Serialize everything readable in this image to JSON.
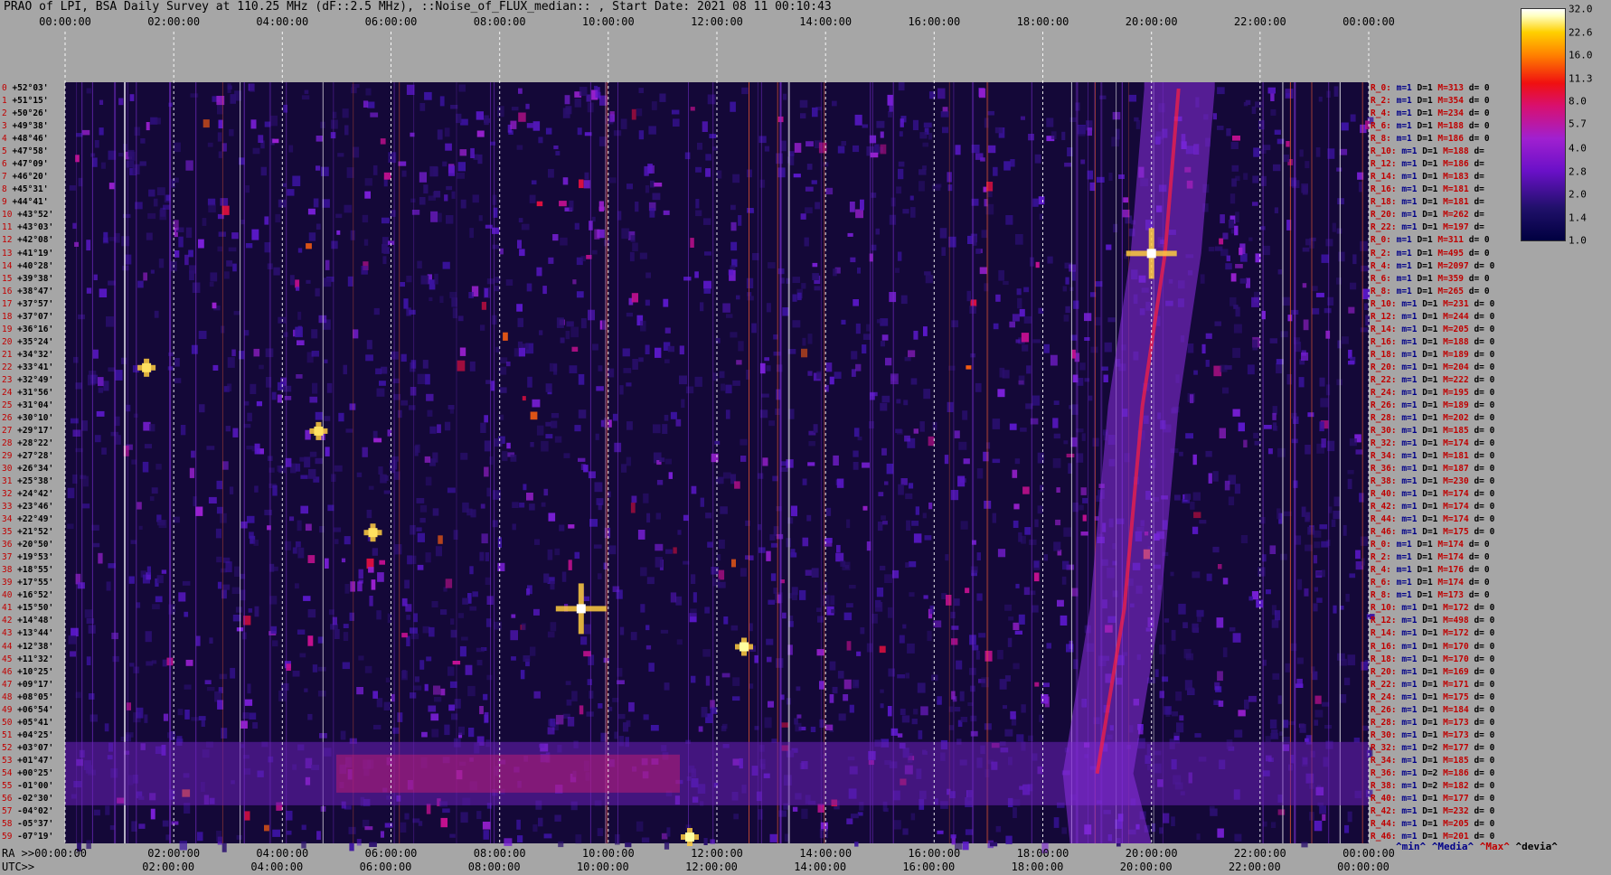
{
  "title": "PRAO of LPI, BSA Daily Survey at 110.25 MHz (dF::2.5 MHz), ::Noise_of_FLUX_median:: , Start Date: 2021 08 11 00:10:43",
  "chart_data": {
    "type": "heatmap",
    "title": "PRAO of LPI, BSA Daily Survey at 110.25 MHz (dF::2.5 MHz), ::Noise_of_FLUX_median:: , Start Date: 2021 08 11 00:10:43",
    "x_ticks_top": [
      "00:00:00",
      "02:00:00",
      "04:00:00",
      "06:00:00",
      "08:00:00",
      "10:00:00",
      "12:00:00",
      "14:00:00",
      "16:00:00",
      "18:00:00",
      "20:00:00",
      "22:00:00",
      "00:00:00"
    ],
    "x_ticks_ra": [
      "02:00:00",
      "04:00:00",
      "06:00:00",
      "08:00:00",
      "10:00:00",
      "12:00:00",
      "14:00:00",
      "16:00:00",
      "18:00:00",
      "20:00:00",
      "22:00:00",
      "00:00:00"
    ],
    "x_ticks_utc": [
      "02:00:00",
      "04:00:00",
      "06:00:00",
      "08:00:00",
      "10:00:00",
      "12:00:00",
      "14:00:00",
      "16:00:00",
      "18:00:00",
      "20:00:00",
      "22:00:00",
      "00:00:00"
    ],
    "ra_label": "RA >>00:00:00",
    "utc_label": "UTC>>",
    "colorbar_ticks": [
      "32.0",
      "22.6",
      "16.0",
      "11.3",
      "8.0",
      "5.7",
      "4.0",
      "2.8",
      "2.0",
      "1.4",
      "1.0"
    ],
    "colorbar_range": [
      1.0,
      32.0
    ],
    "colorbar_scale": "log",
    "dec_labels": [
      {
        "i": "0",
        "d": "+52°03'"
      },
      {
        "i": "1",
        "d": "+51°15'"
      },
      {
        "i": "2",
        "d": "+50°26'"
      },
      {
        "i": "3",
        "d": "+49°38'"
      },
      {
        "i": "4",
        "d": "+48°46'"
      },
      {
        "i": "5",
        "d": "+47°58'"
      },
      {
        "i": "6",
        "d": "+47°09'"
      },
      {
        "i": "7",
        "d": "+46°20'"
      },
      {
        "i": "8",
        "d": "+45°31'"
      },
      {
        "i": "9",
        "d": "+44°41'"
      },
      {
        "i": "10",
        "d": "+43°52'"
      },
      {
        "i": "11",
        "d": "+43°03'"
      },
      {
        "i": "12",
        "d": "+42°08'"
      },
      {
        "i": "13",
        "d": "+41°19'"
      },
      {
        "i": "14",
        "d": "+40°28'"
      },
      {
        "i": "15",
        "d": "+39°38'"
      },
      {
        "i": "16",
        "d": "+38°47'"
      },
      {
        "i": "17",
        "d": "+37°57'"
      },
      {
        "i": "18",
        "d": "+37°07'"
      },
      {
        "i": "19",
        "d": "+36°16'"
      },
      {
        "i": "20",
        "d": "+35°24'"
      },
      {
        "i": "21",
        "d": "+34°32'"
      },
      {
        "i": "22",
        "d": "+33°41'"
      },
      {
        "i": "23",
        "d": "+32°49'"
      },
      {
        "i": "24",
        "d": "+31°56'"
      },
      {
        "i": "25",
        "d": "+31°04'"
      },
      {
        "i": "26",
        "d": "+30°10'"
      },
      {
        "i": "27",
        "d": "+29°17'"
      },
      {
        "i": "28",
        "d": "+28°22'"
      },
      {
        "i": "29",
        "d": "+27°28'"
      },
      {
        "i": "30",
        "d": "+26°34'"
      },
      {
        "i": "31",
        "d": "+25°38'"
      },
      {
        "i": "32",
        "d": "+24°42'"
      },
      {
        "i": "33",
        "d": "+23°46'"
      },
      {
        "i": "34",
        "d": "+22°49'"
      },
      {
        "i": "35",
        "d": "+21°52'"
      },
      {
        "i": "36",
        "d": "+20°50'"
      },
      {
        "i": "37",
        "d": "+19°53'"
      },
      {
        "i": "38",
        "d": "+18°55'"
      },
      {
        "i": "39",
        "d": "+17°55'"
      },
      {
        "i": "40",
        "d": "+16°52'"
      },
      {
        "i": "41",
        "d": "+15°50'"
      },
      {
        "i": "42",
        "d": "+14°48'"
      },
      {
        "i": "43",
        "d": "+13°44'"
      },
      {
        "i": "44",
        "d": "+12°38'"
      },
      {
        "i": "45",
        "d": "+11°32'"
      },
      {
        "i": "46",
        "d": "+10°25'"
      },
      {
        "i": "47",
        "d": "+09°17'"
      },
      {
        "i": "48",
        "d": "+08°05'"
      },
      {
        "i": "49",
        "d": "+06°54'"
      },
      {
        "i": "50",
        "d": "+05°41'"
      },
      {
        "i": "51",
        "d": "+04°25'"
      },
      {
        "i": "52",
        "d": "+03°07'"
      },
      {
        "i": "53",
        "d": "+01°47'"
      },
      {
        "i": "54",
        "d": "+00°25'"
      },
      {
        "i": "55",
        "d": "-01°00'"
      },
      {
        "i": "56",
        "d": "-02°30'"
      },
      {
        "i": "57",
        "d": "-04°02'"
      },
      {
        "i": "58",
        "d": "-05°37'"
      },
      {
        "i": "59",
        "d": "-07°19'"
      }
    ],
    "stats_rows": [
      {
        "r": "R_0:",
        "m": "m=1",
        "D": "D=1",
        "M": "M=313",
        "d": "d= 0"
      },
      {
        "r": "R_2:",
        "m": "m=1",
        "D": "D=1",
        "M": "M=354",
        "d": "d= 0"
      },
      {
        "r": "R_4:",
        "m": "m=1",
        "D": "D=1",
        "M": "M=234",
        "d": "d= 0"
      },
      {
        "r": "R_6:",
        "m": "m=1",
        "D": "D=1",
        "M": "M=188",
        "d": "d= 0"
      },
      {
        "r": "R_8:",
        "m": "m=1",
        "D": "D=1",
        "M": "M=186",
        "d": "d= 0"
      },
      {
        "r": "R_10:",
        "m": "m=1",
        "D": "D=1",
        "M": "M=188",
        "d": "d="
      },
      {
        "r": "R_12:",
        "m": "m=1",
        "D": "D=1",
        "M": "M=186",
        "d": "d="
      },
      {
        "r": "R_14:",
        "m": "m=1",
        "D": "D=1",
        "M": "M=183",
        "d": "d="
      },
      {
        "r": "R_16:",
        "m": "m=1",
        "D": "D=1",
        "M": "M=181",
        "d": "d="
      },
      {
        "r": "R_18:",
        "m": "m=1",
        "D": "D=1",
        "M": "M=181",
        "d": "d="
      },
      {
        "r": "R_20:",
        "m": "m=1",
        "D": "D=1",
        "M": "M=262",
        "d": "d="
      },
      {
        "r": "R_22:",
        "m": "m=1",
        "D": "D=1",
        "M": "M=197",
        "d": "d="
      },
      {
        "r": "R_0:",
        "m": "m=1",
        "D": "D=1",
        "M": "M=311",
        "d": "d= 0"
      },
      {
        "r": "R_2:",
        "m": "m=1",
        "D": "D=1",
        "M": "M=495",
        "d": "d= 0"
      },
      {
        "r": "R_4:",
        "m": "m=1",
        "D": "D=1",
        "M": "M=2097",
        "d": "d= 0"
      },
      {
        "r": "R_6:",
        "m": "m=1",
        "D": "D=1",
        "M": "M=359",
        "d": "d= 0"
      },
      {
        "r": "R_8:",
        "m": "m=1",
        "D": "D=1",
        "M": "M=265",
        "d": "d= 0"
      },
      {
        "r": "R_10:",
        "m": "m=1",
        "D": "D=1",
        "M": "M=231",
        "d": "d= 0"
      },
      {
        "r": "R_12:",
        "m": "m=1",
        "D": "D=1",
        "M": "M=244",
        "d": "d= 0"
      },
      {
        "r": "R_14:",
        "m": "m=1",
        "D": "D=1",
        "M": "M=205",
        "d": "d= 0"
      },
      {
        "r": "R_16:",
        "m": "m=1",
        "D": "D=1",
        "M": "M=188",
        "d": "d= 0"
      },
      {
        "r": "R_18:",
        "m": "m=1",
        "D": "D=1",
        "M": "M=189",
        "d": "d= 0"
      },
      {
        "r": "R_20:",
        "m": "m=1",
        "D": "D=1",
        "M": "M=204",
        "d": "d= 0"
      },
      {
        "r": "R_22:",
        "m": "m=1",
        "D": "D=1",
        "M": "M=222",
        "d": "d= 0"
      },
      {
        "r": "R_24:",
        "m": "m=1",
        "D": "D=1",
        "M": "M=195",
        "d": "d= 0"
      },
      {
        "r": "R_26:",
        "m": "m=1",
        "D": "D=1",
        "M": "M=189",
        "d": "d= 0"
      },
      {
        "r": "R_28:",
        "m": "m=1",
        "D": "D=1",
        "M": "M=202",
        "d": "d= 0"
      },
      {
        "r": "R_30:",
        "m": "m=1",
        "D": "D=1",
        "M": "M=185",
        "d": "d= 0"
      },
      {
        "r": "R_32:",
        "m": "m=1",
        "D": "D=1",
        "M": "M=174",
        "d": "d= 0"
      },
      {
        "r": "R_34:",
        "m": "m=1",
        "D": "D=1",
        "M": "M=181",
        "d": "d= 0"
      },
      {
        "r": "R_36:",
        "m": "m=1",
        "D": "D=1",
        "M": "M=187",
        "d": "d= 0"
      },
      {
        "r": "R_38:",
        "m": "m=1",
        "D": "D=1",
        "M": "M=230",
        "d": "d= 0"
      },
      {
        "r": "R_40:",
        "m": "m=1",
        "D": "D=1",
        "M": "M=174",
        "d": "d= 0"
      },
      {
        "r": "R_42:",
        "m": "m=1",
        "D": "D=1",
        "M": "M=174",
        "d": "d= 0"
      },
      {
        "r": "R_44:",
        "m": "m=1",
        "D": "D=1",
        "M": "M=174",
        "d": "d= 0"
      },
      {
        "r": "R_46:",
        "m": "m=1",
        "D": "D=1",
        "M": "M=175",
        "d": "d= 0"
      },
      {
        "r": "R_0:",
        "m": "m=1",
        "D": "D=1",
        "M": "M=174",
        "d": "d= 0"
      },
      {
        "r": "R_2:",
        "m": "m=1",
        "D": "D=1",
        "M": "M=174",
        "d": "d= 0"
      },
      {
        "r": "R_4:",
        "m": "m=1",
        "D": "D=1",
        "M": "M=176",
        "d": "d= 0"
      },
      {
        "r": "R_6:",
        "m": "m=1",
        "D": "D=1",
        "M": "M=174",
        "d": "d= 0"
      },
      {
        "r": "R_8:",
        "m": "m=1",
        "D": "D=1",
        "M": "M=173",
        "d": "d= 0"
      },
      {
        "r": "R_10:",
        "m": "m=1",
        "D": "D=1",
        "M": "M=172",
        "d": "d= 0"
      },
      {
        "r": "R_12:",
        "m": "m=1",
        "D": "D=1",
        "M": "M=498",
        "d": "d= 0"
      },
      {
        "r": "R_14:",
        "m": "m=1",
        "D": "D=1",
        "M": "M=172",
        "d": "d= 0"
      },
      {
        "r": "R_16:",
        "m": "m=1",
        "D": "D=1",
        "M": "M=170",
        "d": "d= 0"
      },
      {
        "r": "R_18:",
        "m": "m=1",
        "D": "D=1",
        "M": "M=170",
        "d": "d= 0"
      },
      {
        "r": "R_20:",
        "m": "m=1",
        "D": "D=1",
        "M": "M=169",
        "d": "d= 0"
      },
      {
        "r": "R_22:",
        "m": "m=1",
        "D": "D=1",
        "M": "M=171",
        "d": "d= 0"
      },
      {
        "r": "R_24:",
        "m": "m=1",
        "D": "D=1",
        "M": "M=175",
        "d": "d= 0"
      },
      {
        "r": "R_26:",
        "m": "m=1",
        "D": "D=1",
        "M": "M=184",
        "d": "d= 0"
      },
      {
        "r": "R_28:",
        "m": "m=1",
        "D": "D=1",
        "M": "M=173",
        "d": "d= 0"
      },
      {
        "r": "R_30:",
        "m": "m=1",
        "D": "D=1",
        "M": "M=173",
        "d": "d= 0"
      },
      {
        "r": "R_32:",
        "m": "m=1",
        "D": "D=2",
        "M": "M=177",
        "d": "d= 0"
      },
      {
        "r": "R_34:",
        "m": "m=1",
        "D": "D=1",
        "M": "M=185",
        "d": "d= 0"
      },
      {
        "r": "R_36:",
        "m": "m=1",
        "D": "D=2",
        "M": "M=186",
        "d": "d= 0"
      },
      {
        "r": "R_38:",
        "m": "m=1",
        "D": "D=2",
        "M": "M=182",
        "d": "d= 0"
      },
      {
        "r": "R_40:",
        "m": "m=1",
        "D": "D=1",
        "M": "M=177",
        "d": "d= 0"
      },
      {
        "r": "R_42:",
        "m": "m=1",
        "D": "D=1",
        "M": "M=232",
        "d": "d= 0"
      },
      {
        "r": "R_44:",
        "m": "m=1",
        "D": "D=1",
        "M": "M=205",
        "d": "d= 0"
      },
      {
        "r": "R_46:",
        "m": "m=1",
        "D": "D=1",
        "M": "M=201",
        "d": "d= 0"
      }
    ],
    "legend": [
      {
        "text": "^min^",
        "color": "#000088"
      },
      {
        "text": "^Media^",
        "color": "#000088"
      },
      {
        "text": "^Max^",
        "color": "#c00000"
      },
      {
        "text": "^devia^",
        "color": "#000000"
      }
    ],
    "bright_sources": [
      {
        "ra": "20:00:00",
        "dec": "+41°19'",
        "value": 32.0
      },
      {
        "ra": "09:30:00",
        "dec": "+15°50'",
        "value": 32.0
      },
      {
        "ra": "12:30:00",
        "dec": "+12°38'",
        "value": 22.6
      },
      {
        "ra": "05:40:00",
        "dec": "+21°52'",
        "value": 16.0
      },
      {
        "ra": "04:40:00",
        "dec": "+29°17'",
        "value": 16.0
      },
      {
        "ra": "11:30:00",
        "dec": "-07°19'",
        "value": 22.6
      },
      {
        "ra": "01:30:00",
        "dec": "+33°41'",
        "value": 16.0
      }
    ],
    "galactic_plane": [
      {
        "ra": "19:00:00",
        "dec": "+00°25'"
      },
      {
        "ra": "19:30:00",
        "dec": "+15°50'"
      },
      {
        "ra": "19:50:00",
        "dec": "+31°04'"
      },
      {
        "ra": "20:15:00",
        "dec": "+41°19'"
      },
      {
        "ra": "20:30:00",
        "dec": "+52°03'"
      }
    ],
    "horizontal_band_dec": [
      "+01°47'",
      "-01°00'"
    ],
    "grid_dashed": true
  },
  "colors": {
    "background": "#a6a6a6",
    "heat_low": "#140838",
    "accent_red": "#c00000",
    "accent_blue": "#000088"
  }
}
